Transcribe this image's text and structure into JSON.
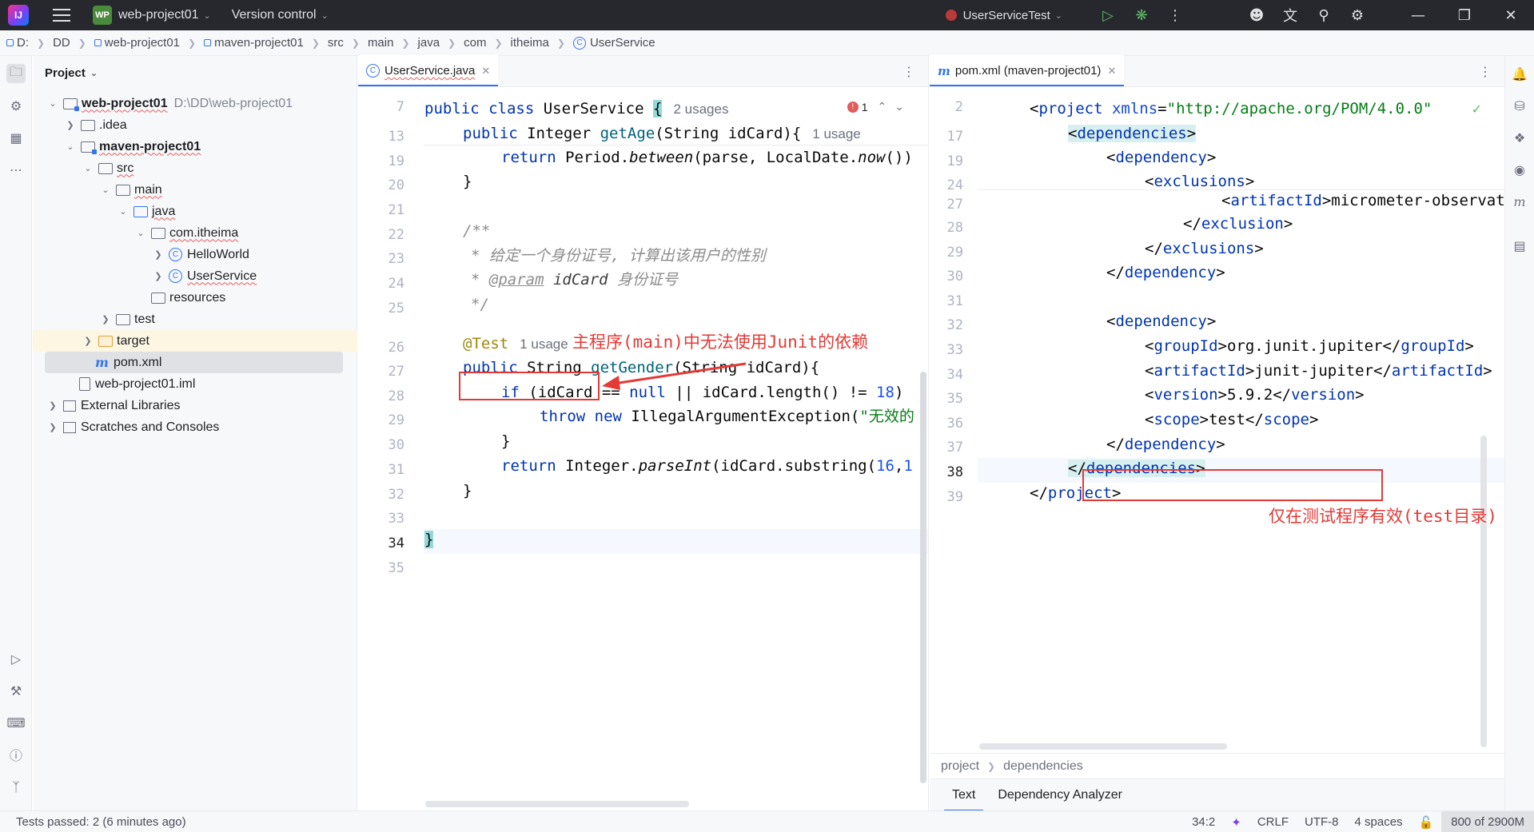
{
  "titlebar": {
    "app_logo": "IJ",
    "project_badge": "WP",
    "project_name": "web-project01",
    "vcs": "Version control",
    "run_config": "UserServiceTest"
  },
  "breadcrumb": [
    "D:",
    "DD",
    "web-project01",
    "maven-project01",
    "src",
    "main",
    "java",
    "com",
    "itheima",
    "UserService"
  ],
  "project_panel": {
    "title": "Project",
    "tree": [
      {
        "label": "web-project01",
        "extra": "D:\\DD\\web-project01"
      },
      {
        "label": ".idea"
      },
      {
        "label": "maven-project01"
      },
      {
        "label": "src"
      },
      {
        "label": "main"
      },
      {
        "label": "java"
      },
      {
        "label": "com.itheima"
      },
      {
        "label": "HelloWorld"
      },
      {
        "label": "UserService"
      },
      {
        "label": "resources"
      },
      {
        "label": "test"
      },
      {
        "label": "target"
      },
      {
        "label": "pom.xml"
      },
      {
        "label": "web-project01.iml"
      },
      {
        "label": "External Libraries"
      },
      {
        "label": "Scratches and Consoles"
      }
    ]
  },
  "editor_left": {
    "tab": "UserService.java",
    "class_usages": "2 usages",
    "error_count": "1",
    "getage_usage": "1 usage",
    "test_usage": "1 usage",
    "gutter": [
      "7",
      "13",
      "19",
      "20",
      "21",
      "22",
      "23",
      "24",
      "25",
      "26",
      "27",
      "28",
      "29",
      "30",
      "31",
      "32",
      "33",
      "34",
      "35"
    ],
    "comment_line1": "* 给定一个身份证号, 计算出该用户的性别",
    "comment_param_tag": "@param",
    "comment_param_name": "idCard",
    "comment_param_desc": "身份证号",
    "exception_msg": "\"无效的",
    "annotation_note": "主程序(main)中无法使用Junit的依赖"
  },
  "editor_right": {
    "tab": "pom.xml (maven-project01)",
    "gutter": [
      "2",
      "17",
      "19",
      "24",
      "27",
      "28",
      "29",
      "30",
      "31",
      "32",
      "33",
      "34",
      "35",
      "36",
      "37",
      "38",
      "39"
    ],
    "xmlns": "\"http://apache.org/POM/4.0.0\"",
    "group_id": "org.junit.jupiter",
    "artifact_id": "junit-jupiter",
    "version": "5.9.2",
    "scope": "test",
    "excl_artifact": "micrometer-observation",
    "annotation_note": "仅在测试程序有效(test目录)",
    "xml_breadcrumb": [
      "project",
      "dependencies"
    ],
    "bottom_tabs": [
      "Text",
      "Dependency Analyzer"
    ]
  },
  "statusbar": {
    "left": "Tests passed: 2 (6 minutes ago)",
    "position": "34:2",
    "line_sep": "CRLF",
    "encoding": "UTF-8",
    "indent": "4 spaces",
    "memory": "800 of 2900M"
  },
  "colors": {
    "accent": "#3574f0",
    "annotation_red": "#e53935",
    "titlebar_bg": "#27282e"
  }
}
